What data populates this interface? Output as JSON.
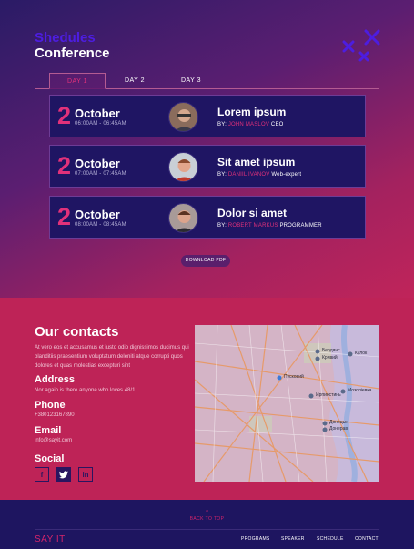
{
  "header": {
    "title_line1": "Shedules",
    "title_line2": "Conference"
  },
  "tabs": [
    {
      "label": "DAY 1",
      "active": true
    },
    {
      "label": "DAY 2",
      "active": false
    },
    {
      "label": "DAY 3",
      "active": false
    }
  ],
  "sessions": [
    {
      "day": "2",
      "month": "October",
      "time": "06:00AM - 06:45AM",
      "title": "Lorem ipsum",
      "by": "BY:",
      "speaker": "JOHN MASLOV",
      "role": "CEO"
    },
    {
      "day": "2",
      "month": "October",
      "time": "07:00AM - 07:45AM",
      "title": "Sit amet ipsum",
      "by": "BY:",
      "speaker": "DANIIL IVANOV",
      "role": "Web-expert"
    },
    {
      "day": "2",
      "month": "October",
      "time": "08:00AM - 08:45AM",
      "title": "Dolor si amet",
      "by": "BY:",
      "speaker": "ROBERT MARKUS",
      "role": "PROGRAMMER"
    }
  ],
  "download_label": "DOWNLOAD PDF",
  "contacts": {
    "title": "Our contacts",
    "description": "At vero eos et accusamus et iusto odio dignissimos ducimus qui blanditiis praesentium voluptatum deleniti atque corrupti quos dolores et quas molestias excepturi sint",
    "address_heading": "Address",
    "address": "Nor again is there anyone who loves  48/1",
    "phone_heading": "Phone",
    "phone": "+380123167890",
    "email_heading": "Email",
    "email": "info@sayit.com",
    "social_heading": "Social",
    "social": [
      {
        "glyph": "f",
        "active": false
      },
      {
        "glyph": "t",
        "active": true
      },
      {
        "glyph": "in",
        "active": false
      }
    ]
  },
  "map": {
    "labels": [
      "Бердянс",
      "Кривий",
      "Кулок",
      "Пусковий",
      "Ирпиостинь",
      "Мозоліевка",
      "Донецьк",
      "Донерав"
    ]
  },
  "footer": {
    "back_to_top": "BACK TO TOP",
    "brand": "SAY IT",
    "nav": [
      "PROGRAMS",
      "SPEAKER",
      "SCHEDULE",
      "CONTACT"
    ]
  },
  "colors": {
    "accent": "#e2317a",
    "navy": "#1e1560",
    "pink": "#be2357",
    "brand_purple": "#4d1de0"
  }
}
